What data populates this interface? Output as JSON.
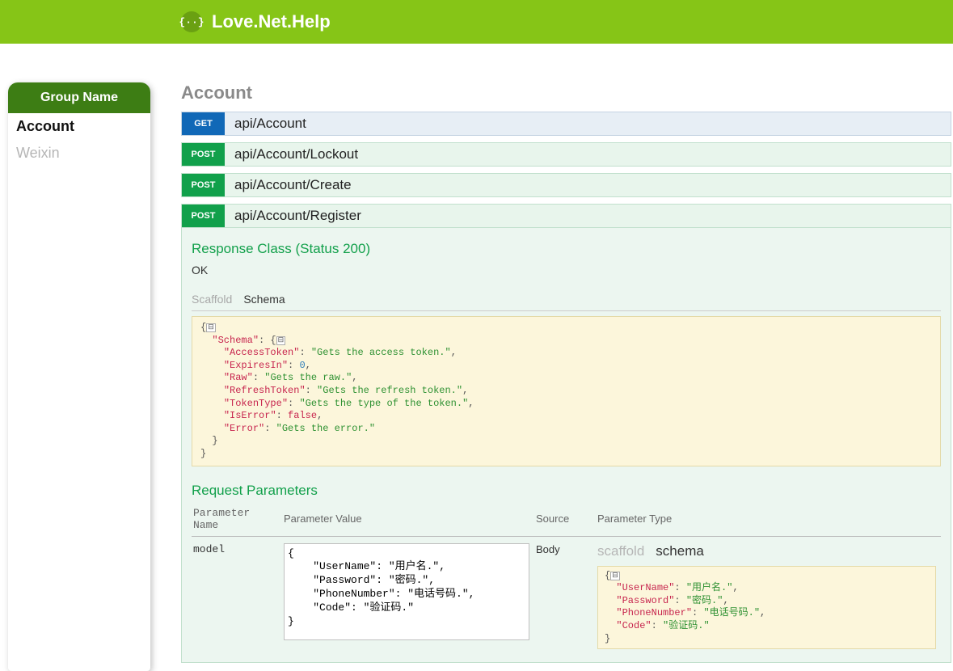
{
  "header": {
    "logo_glyph": "{··}",
    "title": "Love.Net.Help"
  },
  "sidebar": {
    "header": "Group Name",
    "items": [
      {
        "label": "Account",
        "active": true
      },
      {
        "label": "Weixin",
        "active": false
      }
    ]
  },
  "section": {
    "title": "Account"
  },
  "endpoints": [
    {
      "method": "GET",
      "path": "api/Account"
    },
    {
      "method": "POST",
      "path": "api/Account/Lockout"
    },
    {
      "method": "POST",
      "path": "api/Account/Create"
    },
    {
      "method": "POST",
      "path": "api/Account/Register"
    }
  ],
  "response": {
    "title": "Response Class (Status 200)",
    "status_text": "OK",
    "tabs": {
      "scaffold": "Scaffold",
      "schema": "Schema"
    },
    "schema": {
      "name": "Schema",
      "fields": [
        {
          "key": "AccessToken",
          "value": "Gets the access token.",
          "type": "string"
        },
        {
          "key": "ExpiresIn",
          "value": 0,
          "type": "number"
        },
        {
          "key": "Raw",
          "value": "Gets the raw.",
          "type": "string"
        },
        {
          "key": "RefreshToken",
          "value": "Gets the refresh token.",
          "type": "string"
        },
        {
          "key": "TokenType",
          "value": "Gets the type of the token.",
          "type": "string"
        },
        {
          "key": "IsError",
          "value": "false",
          "type": "boolean"
        },
        {
          "key": "Error",
          "value": "Gets the error.",
          "type": "string"
        }
      ]
    }
  },
  "request": {
    "title": "Request Parameters",
    "columns": {
      "name": "Parameter Name",
      "value": "Parameter Value",
      "source": "Source",
      "type": "Parameter Type"
    },
    "row": {
      "name": "model",
      "value_text": "{\n    \"UserName\": \"用户名.\",\n    \"Password\": \"密码.\",\n    \"PhoneNumber\": \"电话号码.\",\n    \"Code\": \"验证码.\"\n}",
      "source": "Body",
      "type_tabs": {
        "scaffold": "scaffold",
        "schema": "schema"
      },
      "schema_fields": [
        {
          "key": "UserName",
          "value": "用户名."
        },
        {
          "key": "Password",
          "value": "密码."
        },
        {
          "key": "PhoneNumber",
          "value": "电话号码."
        },
        {
          "key": "Code",
          "value": "验证码."
        }
      ]
    }
  }
}
